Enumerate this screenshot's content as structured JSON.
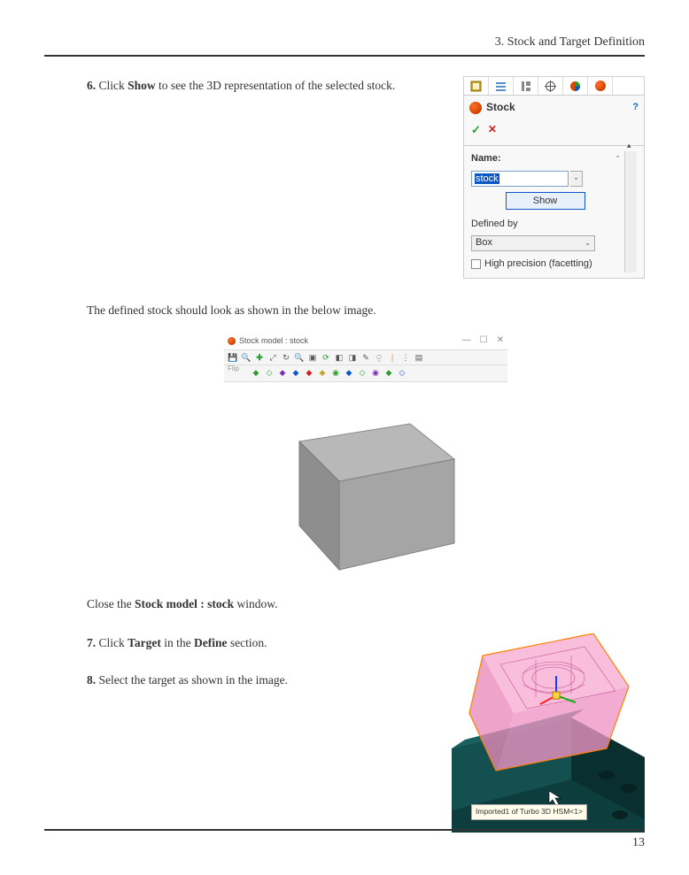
{
  "doc": {
    "chapter": "3. Stock and Target Definition",
    "page_number": "13",
    "steps": {
      "s6_num": "6.",
      "s6_a": "Click ",
      "s6_b": "Show",
      "s6_c": " to see the 3D representation of the selected stock.",
      "defined_text": "The defined stock should look as shown in the below image.",
      "close_a": "Close the ",
      "close_b": "Stock model : stock",
      "close_c": " window.",
      "s7_num": "7.",
      "s7_a": "Click ",
      "s7_b": "Target",
      "s7_c": " in the ",
      "s7_d": "Define",
      "s7_e": " section.",
      "s8_num": "8.",
      "s8_text": "Select the target as shown in the image."
    }
  },
  "stock_panel": {
    "title": "Stock",
    "name_label": "Name:",
    "name_value": "stock",
    "show_btn": "Show",
    "defined_by": "Defined by",
    "box_option": "Box",
    "hp_label": "High precision (facetting)"
  },
  "model_window": {
    "title": "Stock model : stock",
    "flip": "Flip"
  },
  "target_view": {
    "tooltip": "Imported1 of Turbo 3D HSM<1>"
  }
}
